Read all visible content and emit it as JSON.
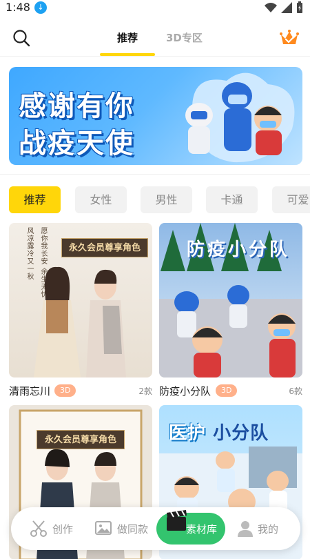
{
  "status_bar": {
    "time": "1:48"
  },
  "header": {
    "tabs": [
      {
        "label": "推荐"
      },
      {
        "label": "3D专区"
      }
    ]
  },
  "banner": {
    "line1": "感谢有你",
    "line2": "战疫天使"
  },
  "chips": [
    {
      "label": "推荐"
    },
    {
      "label": "女性"
    },
    {
      "label": "男性"
    },
    {
      "label": "卡通"
    },
    {
      "label": "可爱"
    }
  ],
  "cards": [
    {
      "name": "清雨忘川",
      "badge": "3D",
      "count": "2款",
      "vip_tag": "永久会员尊享角色",
      "poem1": "风凉露冷又一秋",
      "poem2": "愿你我长安 余生无忧"
    },
    {
      "name": "防疫小分队",
      "badge": "3D",
      "count": "6款",
      "image_title": "防疫小分队"
    },
    {
      "vip_tag": "永久会员尊享角色"
    },
    {
      "image_title_a": "医护",
      "image_title_b": "小分队"
    }
  ],
  "bottom_nav": [
    {
      "label": "创作"
    },
    {
      "label": "做同款"
    },
    {
      "label": "素材库"
    },
    {
      "label": "我的"
    }
  ],
  "colors": {
    "accent": "#ffd60a",
    "badge": "#ffb08a",
    "nav_active": "#33c46e"
  },
  "icons": [
    "search-icon",
    "crown-icon",
    "scissors-icon",
    "image-icon",
    "clapperboard-icon",
    "user-icon"
  ]
}
